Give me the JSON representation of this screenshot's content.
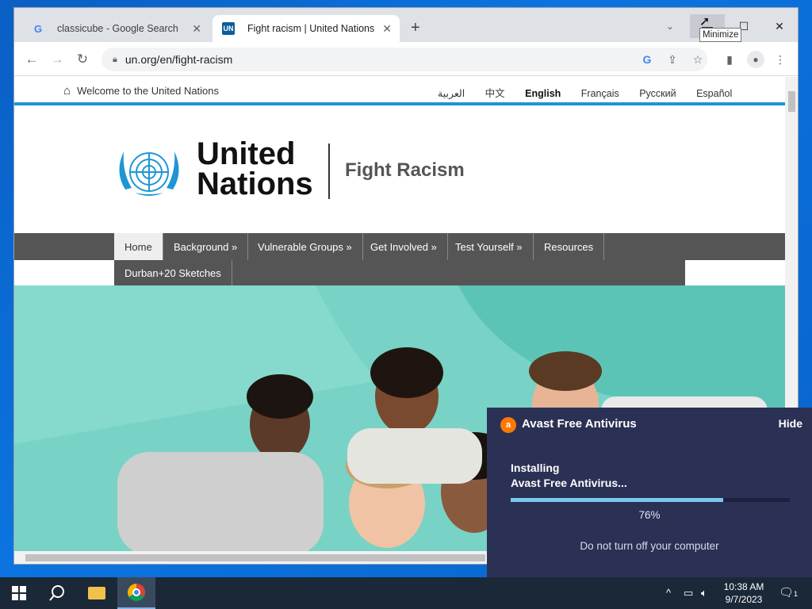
{
  "browser": {
    "tabs": [
      {
        "title": "classicube - Google Search",
        "favicon": "G"
      },
      {
        "title": "Fight racism | United Nations",
        "favicon": "UN"
      }
    ],
    "new_tab": "+",
    "tab_search": "⌄",
    "window_controls": {
      "minimize": "—",
      "maximize": "☐",
      "close": "✕"
    },
    "tooltip": "Minimize",
    "url": "un.org/en/fight-racism",
    "nav": {
      "back": "←",
      "forward": "→",
      "reload": "↻"
    },
    "omnibox_icons": {
      "google": "G",
      "share": "⇪",
      "bookmark": "☆",
      "sidepanel": "▮",
      "profile": "●",
      "menu": "⋮"
    }
  },
  "page": {
    "welcome": "Welcome to the United Nations",
    "home_icon": "⌂",
    "languages": [
      "العربية",
      "中文",
      "English",
      "Français",
      "Русский",
      "Español"
    ],
    "active_language": "English",
    "logo_line1": "United",
    "logo_line2": "Nations",
    "subtitle": "Fight Racism",
    "menu": [
      "Home",
      "Background »",
      "Vulnerable Groups »",
      "Get Involved »",
      "Test Yourself »",
      "Resources"
    ],
    "menu_row2": [
      "Durban+20 Sketches"
    ]
  },
  "avast": {
    "title": "Avast Free Antivirus",
    "hide": "Hide",
    "message_line1": "Installing",
    "message_line2": "Avast Free Antivirus...",
    "progress": 76,
    "progress_label": "76%",
    "warning": "Do not turn off your computer"
  },
  "taskbar": {
    "time": "10:38 AM",
    "date": "9/7/2023",
    "notification_count": "1",
    "tray_icons": [
      "chevron-up-icon",
      "network-icon",
      "volume-muted-icon"
    ]
  }
}
